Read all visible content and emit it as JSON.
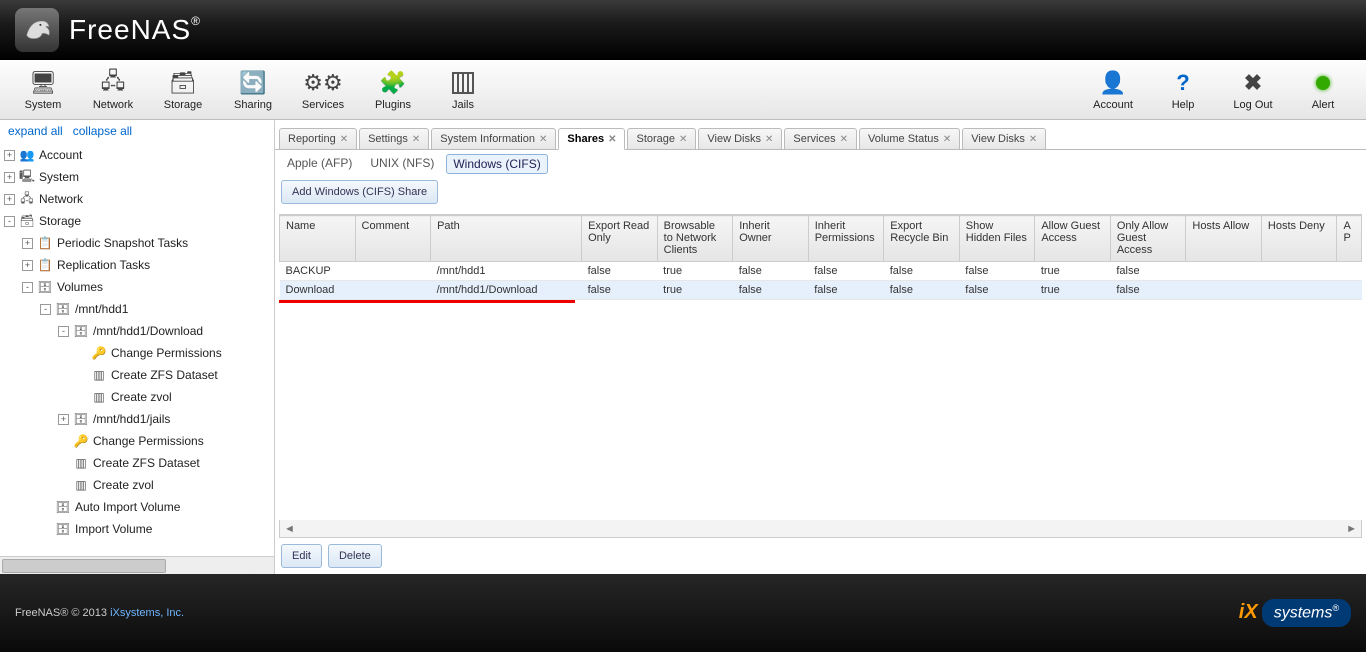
{
  "brand": "FreeNAS",
  "brand_reg": "®",
  "toolbar": [
    {
      "id": "system",
      "label": "System"
    },
    {
      "id": "network",
      "label": "Network"
    },
    {
      "id": "storage",
      "label": "Storage"
    },
    {
      "id": "sharing",
      "label": "Sharing"
    },
    {
      "id": "services",
      "label": "Services"
    },
    {
      "id": "plugins",
      "label": "Plugins"
    },
    {
      "id": "jails",
      "label": "Jails"
    }
  ],
  "toolbar_right": [
    {
      "id": "account",
      "label": "Account"
    },
    {
      "id": "help",
      "label": "Help"
    },
    {
      "id": "logout",
      "label": "Log Out"
    },
    {
      "id": "alert",
      "label": "Alert"
    }
  ],
  "sidebar_actions": {
    "expand": "expand all",
    "collapse": "collapse all"
  },
  "tree": [
    {
      "ind": 1,
      "exp": "+",
      "icon": "👥",
      "label": "Account"
    },
    {
      "ind": 1,
      "exp": "+",
      "icon": "🖳",
      "label": "System"
    },
    {
      "ind": 1,
      "exp": "+",
      "icon": "🖧",
      "label": "Network"
    },
    {
      "ind": 1,
      "exp": "-",
      "icon": "🗃",
      "label": "Storage"
    },
    {
      "ind": 2,
      "exp": "+",
      "icon": "📋",
      "label": "Periodic Snapshot Tasks"
    },
    {
      "ind": 2,
      "exp": "+",
      "icon": "📋",
      "label": "Replication Tasks"
    },
    {
      "ind": 2,
      "exp": "-",
      "icon": "🗄",
      "label": "Volumes"
    },
    {
      "ind": 3,
      "exp": "-",
      "icon": "🗄",
      "label": "/mnt/hdd1"
    },
    {
      "ind": 4,
      "exp": "-",
      "icon": "🗄",
      "label": "/mnt/hdd1/Download"
    },
    {
      "ind": 5,
      "exp": " ",
      "icon": "🔑",
      "label": "Change Permissions"
    },
    {
      "ind": 5,
      "exp": " ",
      "icon": "▥",
      "label": "Create ZFS Dataset"
    },
    {
      "ind": 5,
      "exp": " ",
      "icon": "▥",
      "label": "Create zvol"
    },
    {
      "ind": 4,
      "exp": "+",
      "icon": "🗄",
      "label": "/mnt/hdd1/jails"
    },
    {
      "ind": 4,
      "exp": " ",
      "icon": "🔑",
      "label": "Change Permissions"
    },
    {
      "ind": 4,
      "exp": " ",
      "icon": "▥",
      "label": "Create ZFS Dataset"
    },
    {
      "ind": 4,
      "exp": " ",
      "icon": "▥",
      "label": "Create zvol"
    },
    {
      "ind": 3,
      "exp": " ",
      "icon": "🗄",
      "label": "Auto Import Volume"
    },
    {
      "ind": 3,
      "exp": " ",
      "icon": "🗄",
      "label": "Import Volume"
    }
  ],
  "tabs": [
    {
      "label": "Reporting",
      "closable": true
    },
    {
      "label": "Settings",
      "closable": true
    },
    {
      "label": "System Information",
      "closable": true
    },
    {
      "label": "Shares",
      "closable": true,
      "active": true
    },
    {
      "label": "Storage",
      "closable": true
    },
    {
      "label": "View Disks",
      "closable": true
    },
    {
      "label": "Services",
      "closable": true
    },
    {
      "label": "Volume Status",
      "closable": true
    },
    {
      "label": "View Disks",
      "closable": true
    }
  ],
  "subtabs": [
    {
      "label": "Apple (AFP)"
    },
    {
      "label": "UNIX (NFS)"
    },
    {
      "label": "Windows (CIFS)",
      "active": true
    }
  ],
  "add_share_label": "Add Windows (CIFS) Share",
  "columns": [
    "Name",
    "Comment",
    "Path",
    "Export Read Only",
    "Browsable to Network Clients",
    "Inherit Owner",
    "Inherit Permissions",
    "Export Recycle Bin",
    "Show Hidden Files",
    "Allow Guest Access",
    "Only Allow Guest Access",
    "Hosts Allow",
    "Hosts Deny",
    "A P"
  ],
  "rows": [
    {
      "sel": false,
      "cells": [
        "BACKUP",
        "",
        "/mnt/hdd1",
        "false",
        "true",
        "false",
        "false",
        "false",
        "false",
        "true",
        "false",
        "",
        "",
        ""
      ]
    },
    {
      "sel": true,
      "cells": [
        "Download",
        "",
        "/mnt/hdd1/Download",
        "false",
        "true",
        "false",
        "false",
        "false",
        "false",
        "true",
        "false",
        "",
        "",
        ""
      ]
    }
  ],
  "grid_scroll": {
    "left": "◄",
    "right": "►"
  },
  "grid_buttons": {
    "edit": "Edit",
    "delete": "Delete"
  },
  "footer": {
    "product": "FreeNAS® © 2013 ",
    "company": "iXsystems, Inc.",
    "logo": "systems",
    "reg": "®"
  }
}
